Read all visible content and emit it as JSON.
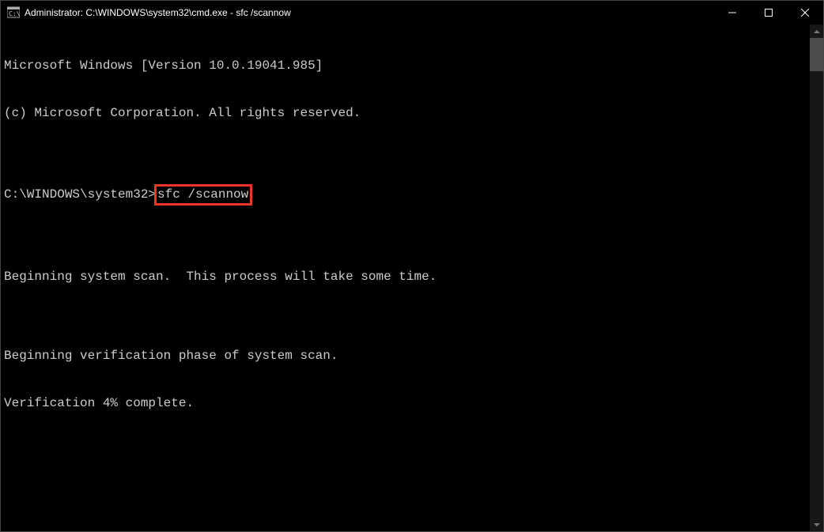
{
  "window": {
    "title": "Administrator: C:\\WINDOWS\\system32\\cmd.exe - sfc  /scannow"
  },
  "terminal": {
    "line1": "Microsoft Windows [Version 10.0.19041.985]",
    "line2": "(c) Microsoft Corporation. All rights reserved.",
    "blank1": "",
    "prompt": "C:\\WINDOWS\\system32>",
    "command": "sfc /scannow",
    "blank2": "",
    "line3": "Beginning system scan.  This process will take some time.",
    "blank3": "",
    "line4": "Beginning verification phase of system scan.",
    "line5": "Verification 4% complete."
  }
}
